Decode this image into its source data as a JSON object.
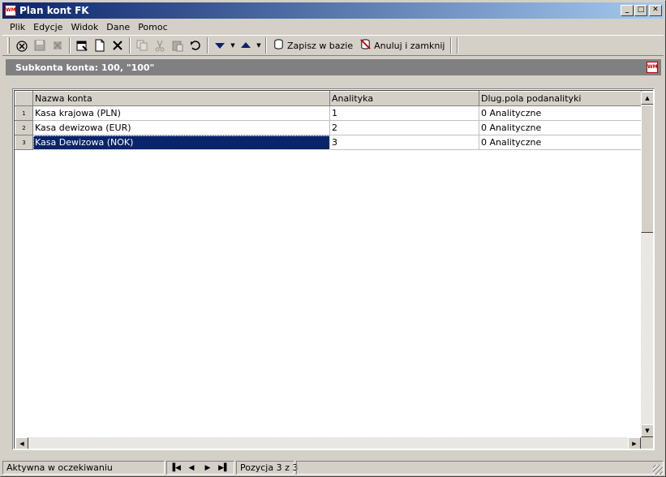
{
  "window": {
    "title": "Plan kont FK",
    "icon": "app-logo-icon",
    "icon_text": "WM"
  },
  "caption_buttons": {
    "minimize": "_",
    "maximize": "□",
    "close": "✕"
  },
  "menu": [
    {
      "label": "Plik"
    },
    {
      "label": "Edycje"
    },
    {
      "label": "Widok"
    },
    {
      "label": "Dane"
    },
    {
      "label": "Pomoc"
    }
  ],
  "toolbar": {
    "save_label": "Zapisz w bazie",
    "cancel_label": "Anuluj i zamknij"
  },
  "subheader": {
    "title": "Subkonta konta: 100, \"100\""
  },
  "grid": {
    "columns": [
      "Nazwa konta",
      "Analityka",
      "Dlug.pola podanalityki"
    ],
    "rows": [
      {
        "num": "1",
        "name": "Kasa krajowa (PLN)",
        "analityka": "1",
        "dlug": "0 Analityczne"
      },
      {
        "num": "2",
        "name": "Kasa dewizowa (EUR)",
        "analityka": "2",
        "dlug": "0 Analityczne"
      },
      {
        "num": "3",
        "name": "Kasa Dewizowa (NOK)",
        "analityka": "3",
        "dlug": "0 Analityczne"
      }
    ],
    "selected_row": 3
  },
  "status": {
    "state": "Aktywna w oczekiwaniu",
    "position": "Pozycja 3 z 3"
  },
  "colors": {
    "title_gradient_start": "#0a246a",
    "title_gradient_end": "#a6caf0",
    "selection": "#0a246a",
    "subheader_bg": "#808080"
  }
}
